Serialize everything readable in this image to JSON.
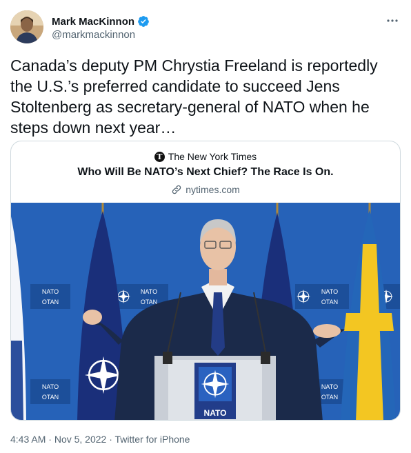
{
  "author": {
    "display_name": "Mark MacKinnon",
    "handle": "@markmackinnon",
    "verified": true,
    "avatar_icon": "avatar-photo"
  },
  "tweet": {
    "text": "Canada’s deputy PM Chrystia Freeland is reportedly the U.S.’s preferred candidate to succeed Jens Stoltenberg as secretary-general of NATO when he steps down next year…"
  },
  "card": {
    "source": "The New York Times",
    "source_logo_letter": "T",
    "title": "Who Will Be NATO’s Next Chief? The Race Is On.",
    "domain": "nytimes.com",
    "image": {
      "backdrop_label_top": "NATO",
      "backdrop_label_bottom": "OTAN",
      "podium_label": "NATO"
    }
  },
  "meta": {
    "time": "4:43 AM",
    "separator": "·",
    "date": "Nov 5, 2022",
    "client": "Twitter for iPhone"
  },
  "colors": {
    "text": "#0f1419",
    "secondary": "#536471",
    "verified": "#1d9bf0",
    "card_border": "#cfd9de",
    "backdrop_blue": "#2a69c0"
  }
}
